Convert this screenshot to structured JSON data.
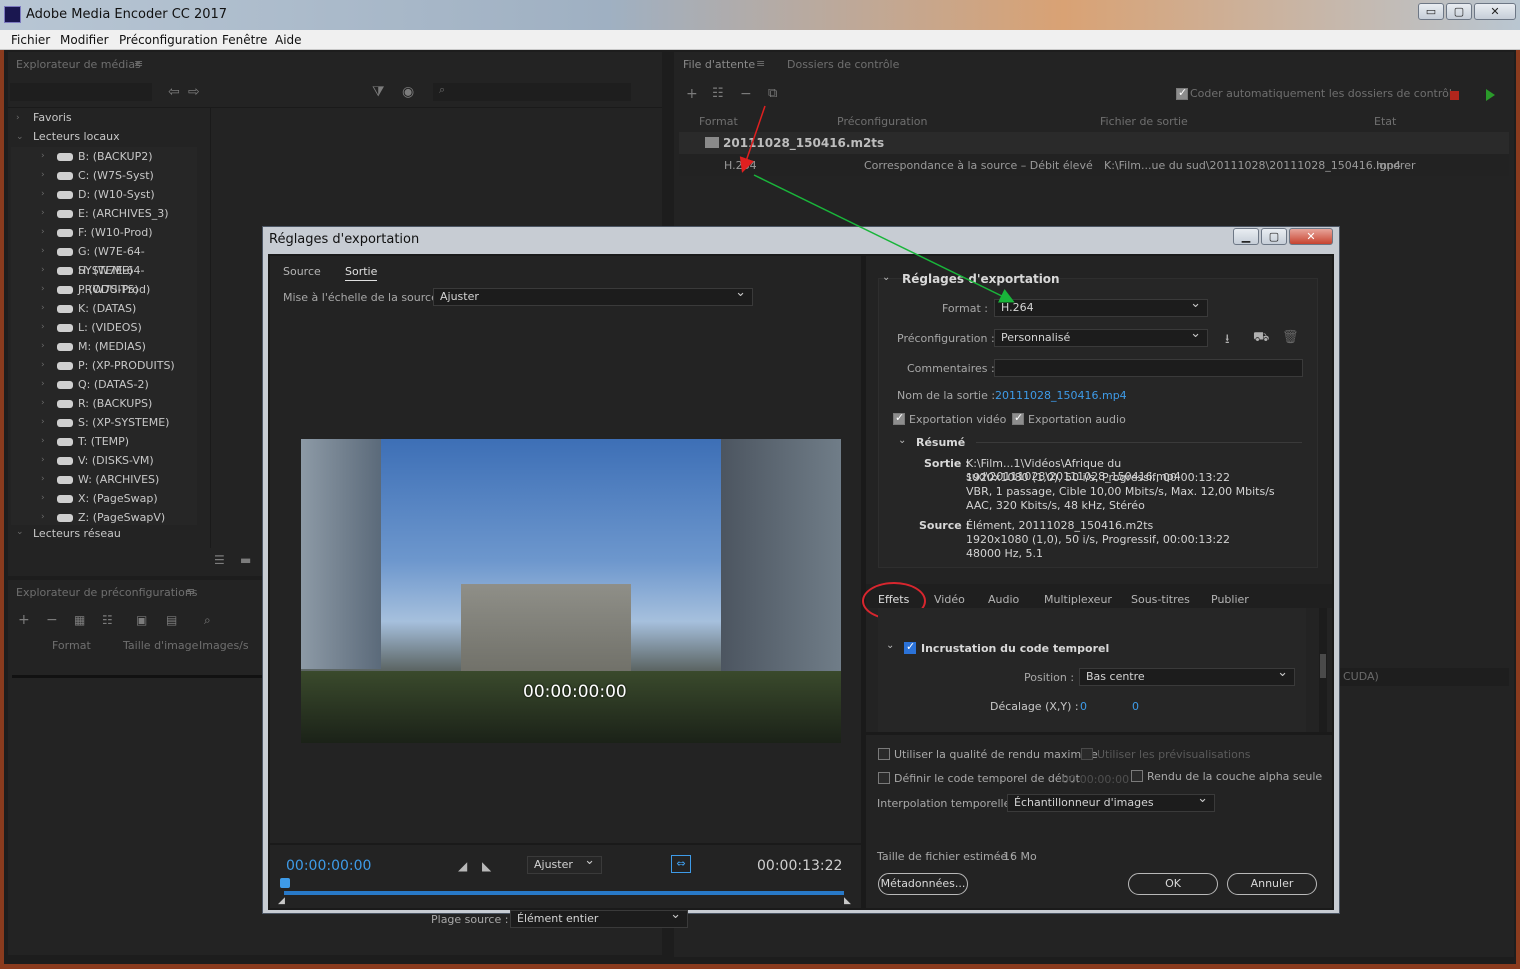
{
  "window": {
    "title": "Adobe Media Encoder CC 2017",
    "min": "▭",
    "max": "▢",
    "close": "✕"
  },
  "menu": [
    "Fichier",
    "Modifier",
    "Préconfiguration",
    "Fenêtre",
    "Aide"
  ],
  "media_browser": {
    "title": "Explorateur de médias",
    "favorites": "Favoris",
    "local_drives": "Lecteurs locaux",
    "drives": [
      "B: (BACKUP2)",
      "C: (W7S-Syst)",
      "D: (W10-Syst)",
      "E: (ARCHIVES_3)",
      "F: (W10-Prod)",
      "G: (W7E-64-SYSTEME)",
      "H: (W7E-64-PRODUITS)",
      "J: (W7S-Prod)",
      "K: (DATAS)",
      "L: (VIDEOS)",
      "M: (MEDIAS)",
      "P: (XP-PRODUITS)",
      "Q: (DATAS-2)",
      "R: (BACKUPS)",
      "S: (XP-SYSTEME)",
      "T: (TEMP)",
      "V: (DISKS-VM)",
      "W: (ARCHIVES)",
      "X: (PageSwap)",
      "Z: (PageSwapV)"
    ],
    "network_drives": "Lecteurs réseau"
  },
  "preset_browser": {
    "title": "Explorateur de préconfigurations",
    "col_format": "Format",
    "col_size": "Taille d'image",
    "col_fps": "Images/s"
  },
  "queue": {
    "tab_queue": "File d'attente",
    "tab_watch": "Dossiers de contrôle",
    "auto_encode": "Coder automatiquement les dossiers de contrôle",
    "col_format": "Format",
    "col_preset": "Préconfiguration",
    "col_output": "Fichier de sortie",
    "col_status": "Etat",
    "item_name": "20111028_150416.m2ts",
    "item_format": "H.264",
    "item_preset": "Correspondance à la source – Débit élevé",
    "item_output": "K:\\Film...ue du sud\\20111028\\20111028_150416.mp4",
    "item_status": "Ignorer",
    "renderer_suffix": "CUDA)"
  },
  "dialog": {
    "title": "Réglages d'exportation",
    "tab_source": "Source",
    "tab_output": "Sortie",
    "scale_label": "Mise à l'échelle de la source :",
    "scale_value": "Ajuster",
    "timecode_overlay": "00:00:00:00",
    "timecode_start": "00:00:00:00",
    "timecode_end": "00:00:13:22",
    "fit": "Ajuster",
    "range_label": "Plage source :",
    "range_value": "Élément entier",
    "export_settings": "Réglages d'exportation",
    "format_label": "Format :",
    "format_value": "H.264",
    "preset_label": "Préconfiguration :",
    "preset_value": "Personnalisé",
    "comments_label": "Commentaires :",
    "output_name_label": "Nom de la sortie :",
    "output_name": "20111028_150416.mp4",
    "export_video": "Exportation vidéo",
    "export_audio": "Exportation audio",
    "summary": "Résumé",
    "out_label": "Sortie :",
    "out_lines": [
      "K:\\Film...1\\Vidéos\\Afrique du sud\\20111028\\20111028_150416.mp4",
      "1920x1080 (1,0), 50 i/s, Progressif, 00:00:13:22",
      "VBR, 1 passage, Cible 10,00  Mbits/s, Max. 12,00  Mbits/s",
      "AAC, 320  Kbits/s, 48 kHz, Stéréo"
    ],
    "src_label": "Source :",
    "src_lines": [
      "Élément, 20111028_150416.m2ts",
      "1920x1080 (1,0), 50 i/s, Progressif, 00:00:13:22",
      "48000 Hz, 5.1"
    ],
    "tabs": [
      "Effets",
      "Vidéo",
      "Audio",
      "Multiplexeur",
      "Sous-titres",
      "Publier"
    ],
    "timecode_burn": "Incrustation du code temporel",
    "position_label": "Position :",
    "position_value": "Bas centre",
    "offset_label": "Décalage (X,Y) :",
    "offset_x": "0",
    "offset_y": "0",
    "max_quality": "Utiliser la qualité de rendu maximale",
    "use_previews": "Utiliser les prévisualisations",
    "start_tc": "Définir le code temporel de début",
    "start_tc_value": "00:00:00:00",
    "alpha_only": "Rendu de la couche alpha seule",
    "interp_label": "Interpolation temporelle :",
    "interp_value": "Échantillonneur d'images",
    "filesize_label": "Taille de fichier estimée :",
    "filesize_value": "16 Mo",
    "metadata_btn": "Métadonnées...",
    "ok_btn": "OK",
    "cancel_btn": "Annuler"
  }
}
